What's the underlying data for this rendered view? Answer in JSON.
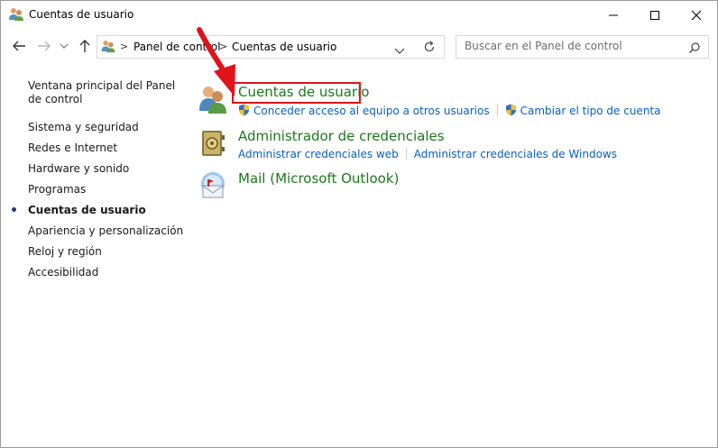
{
  "window": {
    "title": "Cuentas de usuario",
    "controls": {
      "minimize": "—",
      "maximize": "☐",
      "close": "✕"
    }
  },
  "address": {
    "crumbs": [
      "Panel de control",
      "Cuentas de usuario"
    ],
    "separator": ">"
  },
  "search": {
    "placeholder": "Buscar en el Panel de control"
  },
  "sidebar": {
    "home": "Ventana principal del Panel de control",
    "items": [
      "Sistema y seguridad",
      "Redes e Internet",
      "Hardware y sonido",
      "Programas",
      "Cuentas de usuario",
      "Apariencia y personalización",
      "Reloj y región",
      "Accesibilidad"
    ],
    "active_index": 4
  },
  "categories": [
    {
      "title": "Cuentas de usuario",
      "icon": "user-accounts-icon",
      "links": [
        "Conceder acceso al equipo a otros usuarios",
        "Cambiar el tipo de cuenta"
      ],
      "links_have_shield": true
    },
    {
      "title": "Administrador de credenciales",
      "icon": "credential-manager-icon",
      "links": [
        "Administrar credenciales web",
        "Administrar credenciales de Windows"
      ]
    },
    {
      "title": "Mail (Microsoft Outlook)",
      "icon": "mail-icon",
      "links": []
    }
  ],
  "colors": {
    "category_title": "#1a7a1a",
    "link": "#0a60c0",
    "highlight": "#e0141a"
  }
}
